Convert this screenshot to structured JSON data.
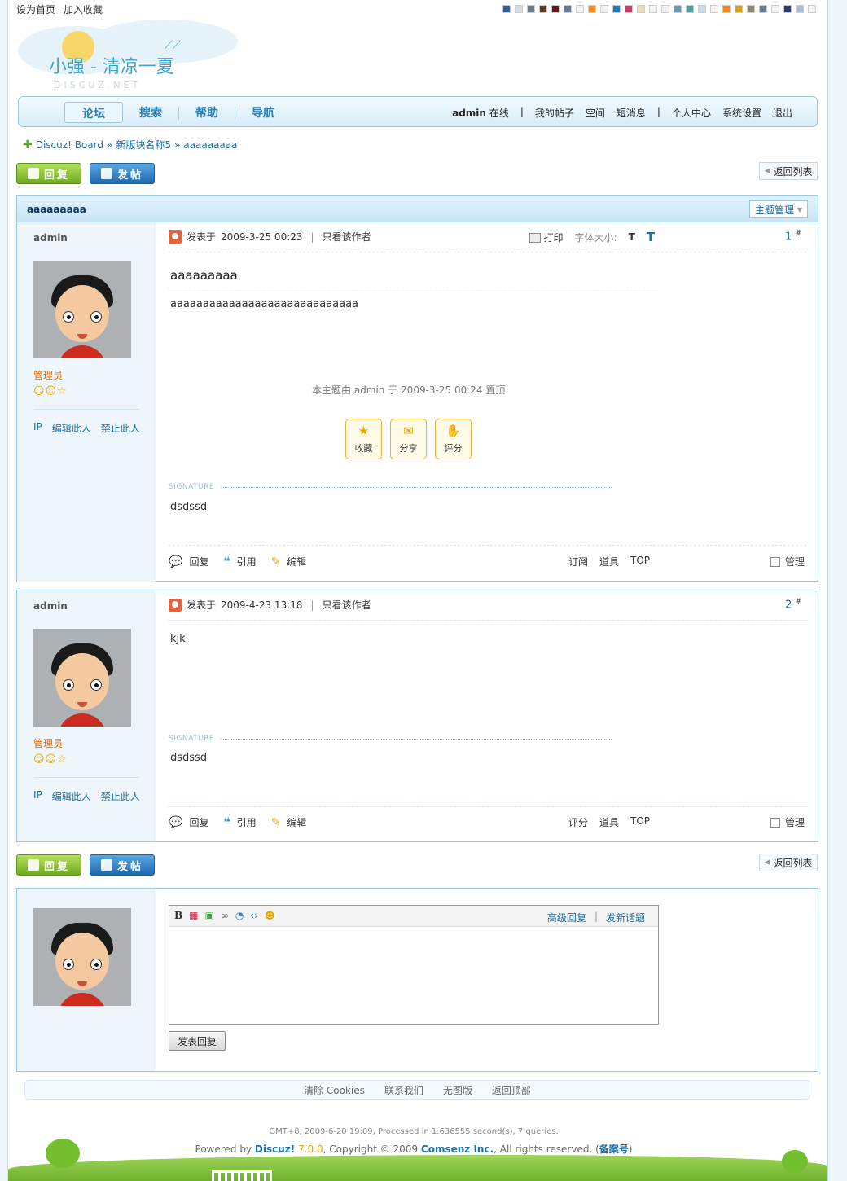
{
  "topbar": {
    "set_home": "设为首页",
    "add_fav": "加入收藏",
    "swatches": [
      "#2b5d9a",
      "#d9dde2",
      "#6b7a8c",
      "#5b3a22",
      "#5a1a1a",
      "#6b7a96",
      "#f4f4f4",
      "#f08c1e",
      "#f4f4f4",
      "#1c7bbf",
      "#c73a6a",
      "#e8e0b8",
      "#f4f4f4",
      "#f4f4f4",
      "#6a9ab0",
      "#4f9fa0",
      "#c8dce6",
      "#f4f4f4",
      "#f08c1e",
      "#d4a21c",
      "#8a8a6a",
      "#6b7a8c",
      "#f4f4f4",
      "#2b3d6a",
      "#a8bcd4",
      "#f4f4f4"
    ]
  },
  "logo": {
    "title": "小强 - 清凉一夏",
    "subtitle": "DISCUZ.NET"
  },
  "nav": {
    "tabs": [
      "论坛",
      "搜索",
      "帮助",
      "导航"
    ],
    "user": "admin",
    "status": "在线",
    "links_a": [
      "我的帖子",
      "空间",
      "短消息"
    ],
    "links_b": [
      "个人中心",
      "系统设置",
      "退出"
    ]
  },
  "breadcrumb": {
    "items": [
      "Discuz! Board",
      "新版块名称5",
      "aaaaaaaaa"
    ]
  },
  "buttons": {
    "reply": "回复",
    "post": "发帖",
    "back": "返回列表"
  },
  "thread": {
    "title": "aaaaaaaaa",
    "manage": "主题管理"
  },
  "posts": [
    {
      "author": "admin",
      "role": "管理员",
      "stars": "☺☺☆",
      "links": [
        "IP",
        "编辑此人",
        "禁止此人"
      ],
      "posted_label": "发表于",
      "time": "2009-3-25 00:23",
      "only_author": "只看该作者",
      "print": "打印",
      "font_size": "字体大小:",
      "font_small": "T",
      "font_large": "T",
      "floor": "1",
      "floor_mark": "#",
      "subject": "aaaaaaaaa",
      "body": "aaaaaaaaaaaaaaaaaaaaaaaaaaaaa",
      "sticky": "本主题由 admin 于 2009-3-25 00:24 置顶",
      "actions": [
        {
          "icon": "star-icon",
          "label": "收藏"
        },
        {
          "icon": "envelope-icon",
          "label": "分享"
        },
        {
          "icon": "thumb-icon",
          "label": "评分"
        }
      ],
      "signature_label": "SIGNATURE",
      "signature": "dsdssd",
      "foot_left": [
        "回复",
        "引用",
        "编辑"
      ],
      "foot_mid": [
        "订阅",
        "道具",
        "TOP"
      ],
      "manage": "管理"
    },
    {
      "author": "admin",
      "role": "管理员",
      "stars": "☺☺☆",
      "links": [
        "IP",
        "编辑此人",
        "禁止此人"
      ],
      "posted_label": "发表于",
      "time": "2009-4-23 13:18",
      "only_author": "只看该作者",
      "floor": "2",
      "floor_mark": "#",
      "body": "kjk",
      "signature_label": "SIGNATURE",
      "signature": "dsdssd",
      "foot_left": [
        "回复",
        "引用",
        "编辑"
      ],
      "foot_mid": [
        "评分",
        "道具",
        "TOP"
      ],
      "manage": "管理"
    }
  ],
  "quick_reply": {
    "advanced": "高级回复",
    "new_topic": "发新话题",
    "submit": "发表回复",
    "bold": "B"
  },
  "footer": {
    "links": [
      "清除 Cookies",
      "联系我们",
      "无图版",
      "返回顶部"
    ],
    "gmt": "GMT+8, 2009-6-20 19:09, Processed in 1.636555 second(s), 7 queries.",
    "powered_by": "Powered by",
    "product": "Discuz!",
    "version": "7.0.0",
    "copyright": ", Copyright © 2009",
    "company": "Comsenz Inc.",
    "rights": ", All rights reserved. (",
    "icp": "备案号",
    "close": ")"
  }
}
